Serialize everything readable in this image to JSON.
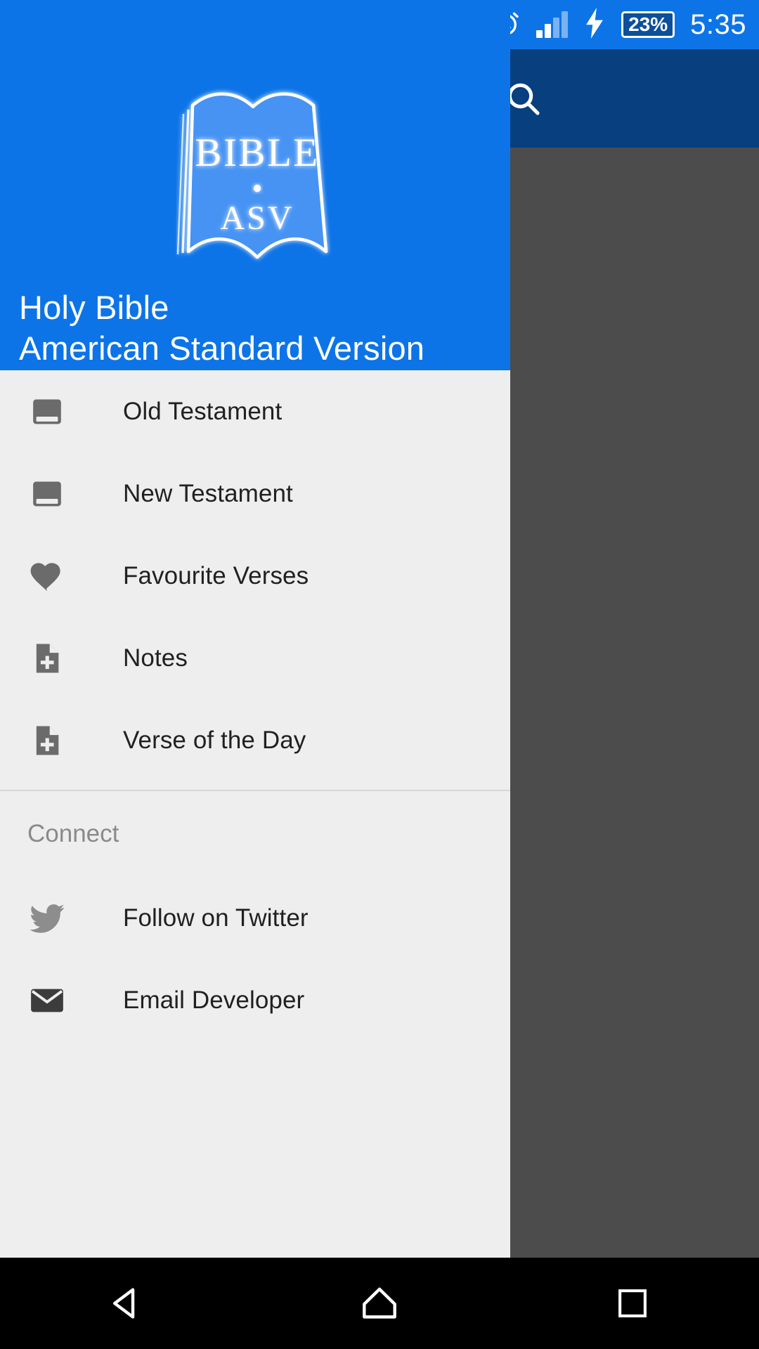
{
  "status_bar": {
    "left_icons": [
      "usb-icon",
      "screenshot-image-icon",
      "android-debug-icon"
    ],
    "right_icons": [
      "alarm-clock-icon",
      "signal-bars-icon",
      "charging-bolt-icon"
    ],
    "battery_percent": "23%",
    "time": "5:35",
    "background_color": "#0D74E7"
  },
  "drawer": {
    "background_color": "#eeeeee",
    "header": {
      "background_color": "#0D74E7",
      "logo": {
        "name": "bible-asv-shield-logo",
        "primary_text": "BIBLE",
        "secondary_text": "ASV"
      },
      "title_line1": "Holy Bible",
      "title_line2": "American Standard Version",
      "title_color": "#ffffff"
    },
    "items": [
      {
        "label": "Old Testament",
        "icon": "book-icon"
      },
      {
        "label": "New Testament",
        "icon": "book-icon"
      },
      {
        "label": "Favourite Verses",
        "icon": "heart-icon"
      },
      {
        "label": "Notes",
        "icon": "note-add-icon"
      },
      {
        "label": "Verse of the Day",
        "icon": "note-add-icon"
      }
    ],
    "section_connect": {
      "title": "Connect",
      "items": [
        {
          "label": "Follow on Twitter",
          "icon": "twitter-bird-icon"
        },
        {
          "label": "Email Developer",
          "icon": "email-envelope-icon"
        }
      ]
    },
    "icon_color": "#6b6b6b",
    "label_color": "#212121",
    "section_label_color": "#8a8a8a"
  },
  "background_app": {
    "toolbar_color": "#0D74E7",
    "search_icon": "search-icon",
    "overflow_icon": "more-vertical-icon"
  },
  "navigation_bar": {
    "background_color": "#000000",
    "buttons": [
      {
        "name": "back-button",
        "icon": "triangle-back-icon"
      },
      {
        "name": "home-button",
        "icon": "home-icon"
      },
      {
        "name": "recents-button",
        "icon": "square-recents-icon"
      }
    ]
  }
}
